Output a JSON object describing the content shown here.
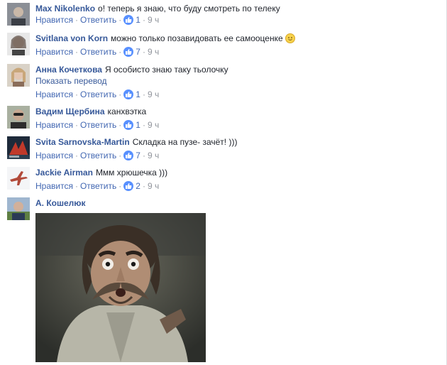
{
  "actions": {
    "like": "Нравится",
    "reply": "Ответить",
    "sep": "·"
  },
  "colors": {
    "link": "#365899",
    "action": "#4267b2",
    "meta": "#90949c",
    "like_badge": "#5890ff"
  },
  "comments": [
    {
      "author": "Max Nikolenko",
      "text": "о! теперь я знаю, что буду смотреть по телеку",
      "likes": "1",
      "time": "9 ч",
      "avatar_icon": "profile-photo-icon"
    },
    {
      "author": "Svitlana von Korn",
      "text": "можно только позавидовать ее самооценке",
      "likes": "7",
      "time": "9 ч",
      "emoji": "slightly-smiling-face-icon",
      "avatar_icon": "profile-photo-icon"
    },
    {
      "author": "Анна Кочеткова",
      "text": "Я особисто знаю таку тьолочку",
      "translate": "Показать перевод",
      "likes": "1",
      "time": "9 ч",
      "avatar_icon": "profile-photo-icon"
    },
    {
      "author": "Вадим Щербина",
      "text": "канхвэтка",
      "likes": "1",
      "time": "9 ч",
      "avatar_icon": "profile-photo-icon"
    },
    {
      "author": "Svita Sarnovska-Martin",
      "text": "Складка на пузе- зачёт! )))",
      "likes": "7",
      "time": "9 ч",
      "avatar_icon": "profile-photo-icon"
    },
    {
      "author": "Jackie Airman",
      "text": "Ммм хрюшечка )))",
      "likes": "2",
      "time": "9 ч",
      "avatar_icon": "airplane-icon"
    },
    {
      "author": "А. Кошелюк",
      "text": "",
      "attachment_icon": "comment-photo-surprised-man",
      "avatar_icon": "profile-photo-icon"
    }
  ]
}
